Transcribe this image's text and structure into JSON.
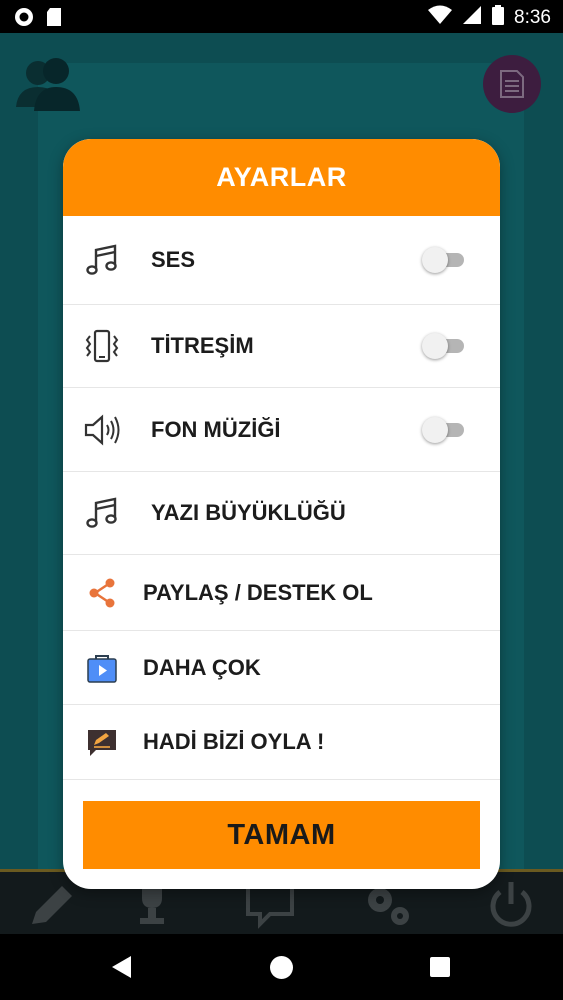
{
  "status_bar": {
    "time": "8:36",
    "icons": [
      "circle-status-icon",
      "sd-card-icon",
      "wifi-icon",
      "signal-icon",
      "battery-icon"
    ]
  },
  "dialog": {
    "title": "AYARLAR",
    "items": [
      {
        "label": "SES",
        "icon": "music-note-icon",
        "has_toggle": true,
        "toggle_on": false
      },
      {
        "label": "TİTREŞİM",
        "icon": "vibration-phone-icon",
        "has_toggle": true,
        "toggle_on": false
      },
      {
        "label": "FON MÜZİĞİ",
        "icon": "speaker-icon",
        "has_toggle": true,
        "toggle_on": false
      },
      {
        "label": "YAZI BÜYÜKLÜĞÜ",
        "icon": "music-note-icon",
        "has_toggle": false
      },
      {
        "label": "PAYLAŞ / DESTEK OL",
        "icon": "share-icon",
        "has_toggle": false
      },
      {
        "label": "DAHA ÇOK",
        "icon": "play-store-bag-icon",
        "has_toggle": false
      },
      {
        "label": "HADİ BİZİ OYLA !",
        "icon": "rate-pen-icon",
        "has_toggle": false
      }
    ],
    "ok_label": "TAMAM"
  },
  "background": {
    "icons": [
      "contacts-icon",
      "document-icon",
      "pencil-icon",
      "trophy-icon",
      "chat-icon",
      "settings-gears-icon",
      "power-icon"
    ]
  },
  "nav_bar": {
    "icons": [
      "back-icon",
      "home-icon",
      "recents-icon"
    ]
  },
  "colors": {
    "accent": "#ff8c00",
    "background_teal": "#0d4d52",
    "dialog_bg": "#ffffff",
    "text_dark": "#1c1c1c"
  }
}
